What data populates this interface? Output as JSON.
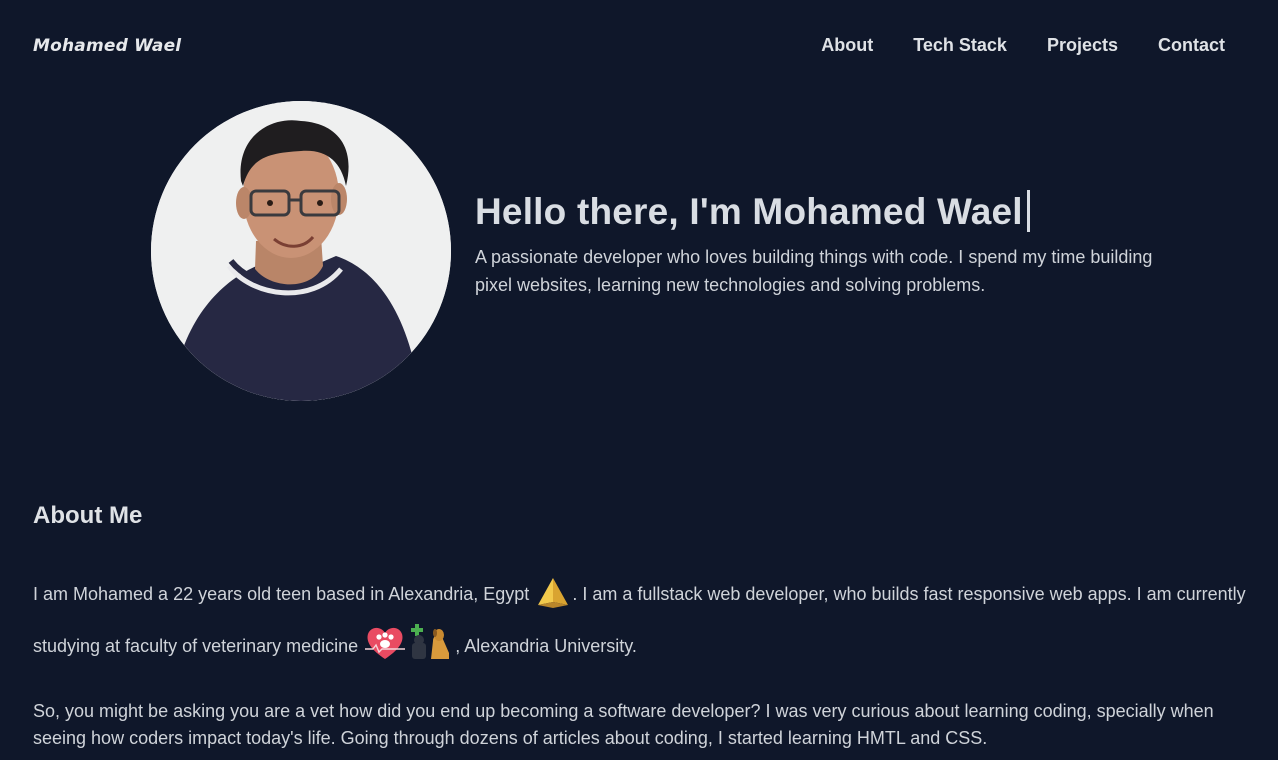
{
  "header": {
    "logo": "Mohamed Wael",
    "nav": [
      "About",
      "Tech Stack",
      "Projects",
      "Contact"
    ]
  },
  "hero": {
    "title": "Hello there, I'm Mohamed Wael",
    "subtitle": "A passionate developer who loves building things with code. I spend my time building pixel websites, learning new technologies and solving problems."
  },
  "about": {
    "title": "About Me",
    "p1": {
      "a": "I am Mohamed a 22 years old teen based in Alexandria, Egypt",
      "b": ". I am a fullstack web developer, who builds fast responsive web apps. I am currently studying at faculty of veterinary medicine",
      "c": ", Alexandria University."
    },
    "p2": "So, you might be asking you are a vet how did you end up becoming a software developer? I was very curious about learning coding, specially when seeing how coders impact today's life. Going through dozens of articles about coding, I started learning HMTL and CSS."
  },
  "icons": {
    "pyramid": "pyramid-icon",
    "heart_paw": "heart-paw-icon",
    "vet": "veterinary-icon"
  },
  "colors": {
    "background": "#0f172a",
    "text": "#d4d8de"
  }
}
